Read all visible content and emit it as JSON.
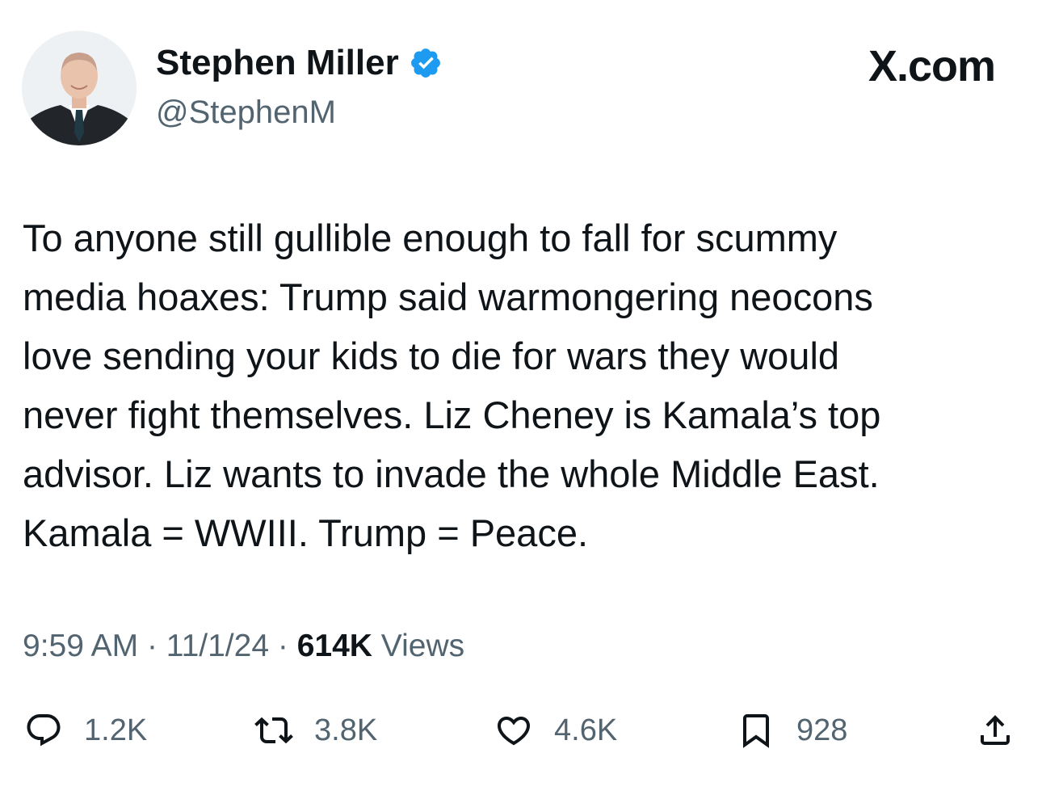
{
  "author": {
    "name": "Stephen Miller",
    "handle": "@StephenM",
    "verified": true,
    "verified_color": "#1d9bf0"
  },
  "brand": {
    "label": "X.com"
  },
  "tweet": {
    "lines": [
      "To anyone still gullible enough to fall for scummy",
      "media hoaxes: Trump said warmongering neocons",
      "love sending your kids to die for wars they would",
      "never fight themselves. Liz Cheney is Kamala’s top",
      "advisor. Liz wants to invade the whole Middle East.",
      "Kamala = WWIII. Trump = Peace."
    ]
  },
  "meta": {
    "time": "9:59 AM",
    "separator": "·",
    "date": "11/1/24",
    "views_count": "614K",
    "views_label": "Views"
  },
  "actions": {
    "replies": {
      "icon": "reply-icon",
      "count": "1.2K"
    },
    "reposts": {
      "icon": "repost-icon",
      "count": "3.8K"
    },
    "likes": {
      "icon": "heart-icon",
      "count": "4.6K"
    },
    "bookmarks": {
      "icon": "bookmark-icon",
      "count": "928"
    },
    "share": {
      "icon": "share-icon"
    }
  },
  "colors": {
    "text_primary": "#0f1419",
    "text_secondary": "#536471",
    "background": "#ffffff"
  }
}
